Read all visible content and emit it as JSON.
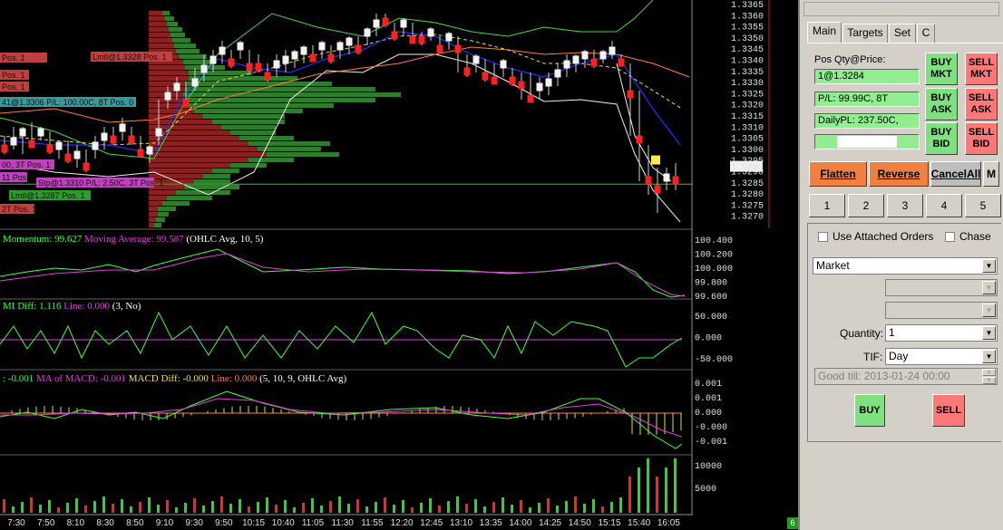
{
  "price_axis": [
    "1.3365",
    "1.3360",
    "1.3355",
    "1.3350",
    "1.3345",
    "1.3340",
    "1.3335",
    "1.3330",
    "1.3325",
    "1.3320",
    "1.3315",
    "1.3310",
    "1.3305",
    "1.3300",
    "1.3295",
    "1.3290",
    "1.3285",
    "1.3280",
    "1.3275",
    "1.3270"
  ],
  "current_price_tag": "1.3292",
  "momentum_axis": [
    "100.400",
    "100.200",
    "100.000",
    "99.800",
    "99.600"
  ],
  "dmi_axis": [
    "50.000",
    "0.000",
    "-50.000"
  ],
  "macd_axis": [
    "0.001",
    "0.001",
    "0.000",
    "-0.000",
    "-0.001"
  ],
  "volume_axis": [
    "10000",
    "5000"
  ],
  "time_axis": [
    "7:30",
    "7:50",
    "8:10",
    "8:30",
    "8:50",
    "9:10",
    "9:30",
    "9:50",
    "10:15",
    "10:40",
    "11:05",
    "11:30",
    "11:55",
    "12:20",
    "12:45",
    "13:10",
    "13:35",
    "14:00",
    "14:25",
    "14:50",
    "15:15",
    "15:40",
    "16:05"
  ],
  "order_tags": [
    "Pos. 1",
    "Pos. 1",
    "Pos. 1",
    "Lmtl@1.3328 Pos. 1",
    "41@1.3306 P/L: 100.00C, 8T Pos. 0",
    "00, 3T Pos. 1",
    "11 Pos. 1",
    "Stp@1.3310 P/L: 2.50C, 3T Pos. 1",
    "Lmtl@1.3287 Pos. 1",
    "2T Pos. 1"
  ],
  "pos_tag": "1",
  "indicators": {
    "momentum": {
      "name": "Momentum: 99.627",
      "ma": "Moving Average: 99.587",
      "params": "(OHLC Avg, 10, 5)"
    },
    "dmi": {
      "name": "MI Diff: 1.116",
      "line": "Line: 0.000",
      "params": "(3, No)"
    },
    "macd": {
      "name": ": -0.001",
      "ma": "MA of MACD: -0.001",
      "diff": "MACD Diff: -0.000",
      "line": "Line: 0.000",
      "params": "(5, 10, 9, OHLC Avg)"
    }
  },
  "colors": {
    "bull": "#22dd22",
    "bear": "#ff2020",
    "support_line": "#22cc22",
    "momentum": "#44ff44",
    "ma": "#e040e0",
    "envelope": "#44dd44",
    "fast_ma": "#2030ff",
    "slow_ma": "#ff8030",
    "profile_sell": "#8b2020",
    "profile_buy": "#2d7d2d"
  },
  "corner_badge": "6",
  "panel": {
    "tabs": [
      "Main",
      "Targets",
      "Set",
      "C"
    ],
    "pos_label": "Pos Qty@Price:",
    "pos_value": "1@1.3284",
    "pl_value": "P/L: 99.99C, 8T",
    "daily_pl_value": "DailyPL: 237.50C,",
    "buy_mkt": "BUY MKT",
    "sell_mkt": "SELL MKT",
    "buy_ask": "BUY ASK",
    "sell_ask": "SELL ASK",
    "buy_bid": "BUY BID",
    "sell_bid": "SELL BID",
    "flatten": "Flatten",
    "reverse": "Reverse",
    "cancel_all": "CancelAll",
    "m": "M",
    "quick": [
      "1",
      "2",
      "3",
      "4",
      "5"
    ],
    "attached_orders": "Use Attached Orders",
    "chase": "Chase",
    "order_type": "Market",
    "quantity_label": "Quantity:",
    "quantity": "1",
    "tif_label": "TIF:",
    "tif": "Day",
    "good_till": "Good till: 2013-01-24 00:00",
    "buy": "BUY",
    "sell": "SELL"
  }
}
